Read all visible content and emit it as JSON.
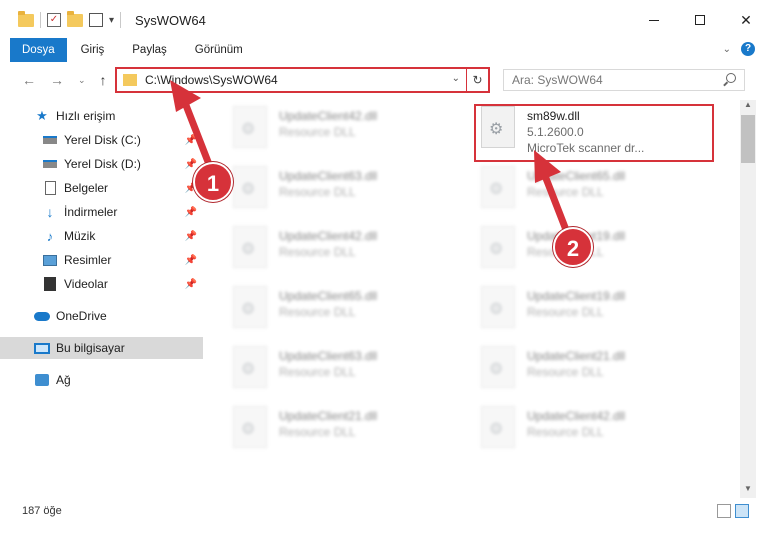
{
  "window": {
    "title": "SysWOW64"
  },
  "ribbon": {
    "tabs": [
      "Dosya",
      "Giriş",
      "Paylaş",
      "Görünüm"
    ]
  },
  "address": {
    "path": "C:\\Windows\\SysWOW64",
    "search_placeholder": "Ara: SysWOW64"
  },
  "sidebar": {
    "items": [
      {
        "label": "Hızlı erişim",
        "icon": "star-icon"
      },
      {
        "label": "Yerel Disk (C:)",
        "icon": "disk-icon",
        "pinned": true
      },
      {
        "label": "Yerel Disk (D:)",
        "icon": "disk-icon",
        "pinned": true
      },
      {
        "label": "Belgeler",
        "icon": "document-icon",
        "pinned": true
      },
      {
        "label": "İndirmeler",
        "icon": "download-icon",
        "pinned": true
      },
      {
        "label": "Müzik",
        "icon": "music-icon",
        "pinned": true
      },
      {
        "label": "Resimler",
        "icon": "pictures-icon",
        "pinned": true
      },
      {
        "label": "Videolar",
        "icon": "video-icon",
        "pinned": true
      },
      {
        "label": "OneDrive",
        "icon": "cloud-icon"
      },
      {
        "label": "Bu bilgisayar",
        "icon": "computer-icon",
        "selected": true
      },
      {
        "label": "Ağ",
        "icon": "network-icon"
      }
    ]
  },
  "files": [
    {
      "name": "UpdateClient42.dll",
      "type": "Resource DLL"
    },
    {
      "name": "sm89w.dll",
      "version": "5.1.2600.0",
      "description": "MicroTek scanner dr..."
    },
    {
      "name": "UpdateClient63.dll",
      "type": "Resource DLL"
    },
    {
      "name": "UpdateClient65.dll",
      "type": "Resource DLL"
    },
    {
      "name": "UpdateClient42.dll",
      "type": "Resource DLL"
    },
    {
      "name": "UpdateClient19.dll",
      "type": "Resource DLL"
    },
    {
      "name": "UpdateClient65.dll",
      "type": "Resource DLL"
    },
    {
      "name": "UpdateClient19.dll",
      "type": "Resource DLL"
    },
    {
      "name": "UpdateClient63.dll",
      "type": "Resource DLL"
    },
    {
      "name": "UpdateClient21.dll",
      "type": "Resource DLL"
    },
    {
      "name": "UpdateClient21.dll",
      "type": "Resource DLL"
    },
    {
      "name": "UpdateClient42.dll",
      "type": "Resource DLL"
    }
  ],
  "status": {
    "item_count": "187 öğe"
  },
  "annotations": {
    "callout1": "1",
    "callout2": "2",
    "highlight_color": "#d6323a"
  }
}
